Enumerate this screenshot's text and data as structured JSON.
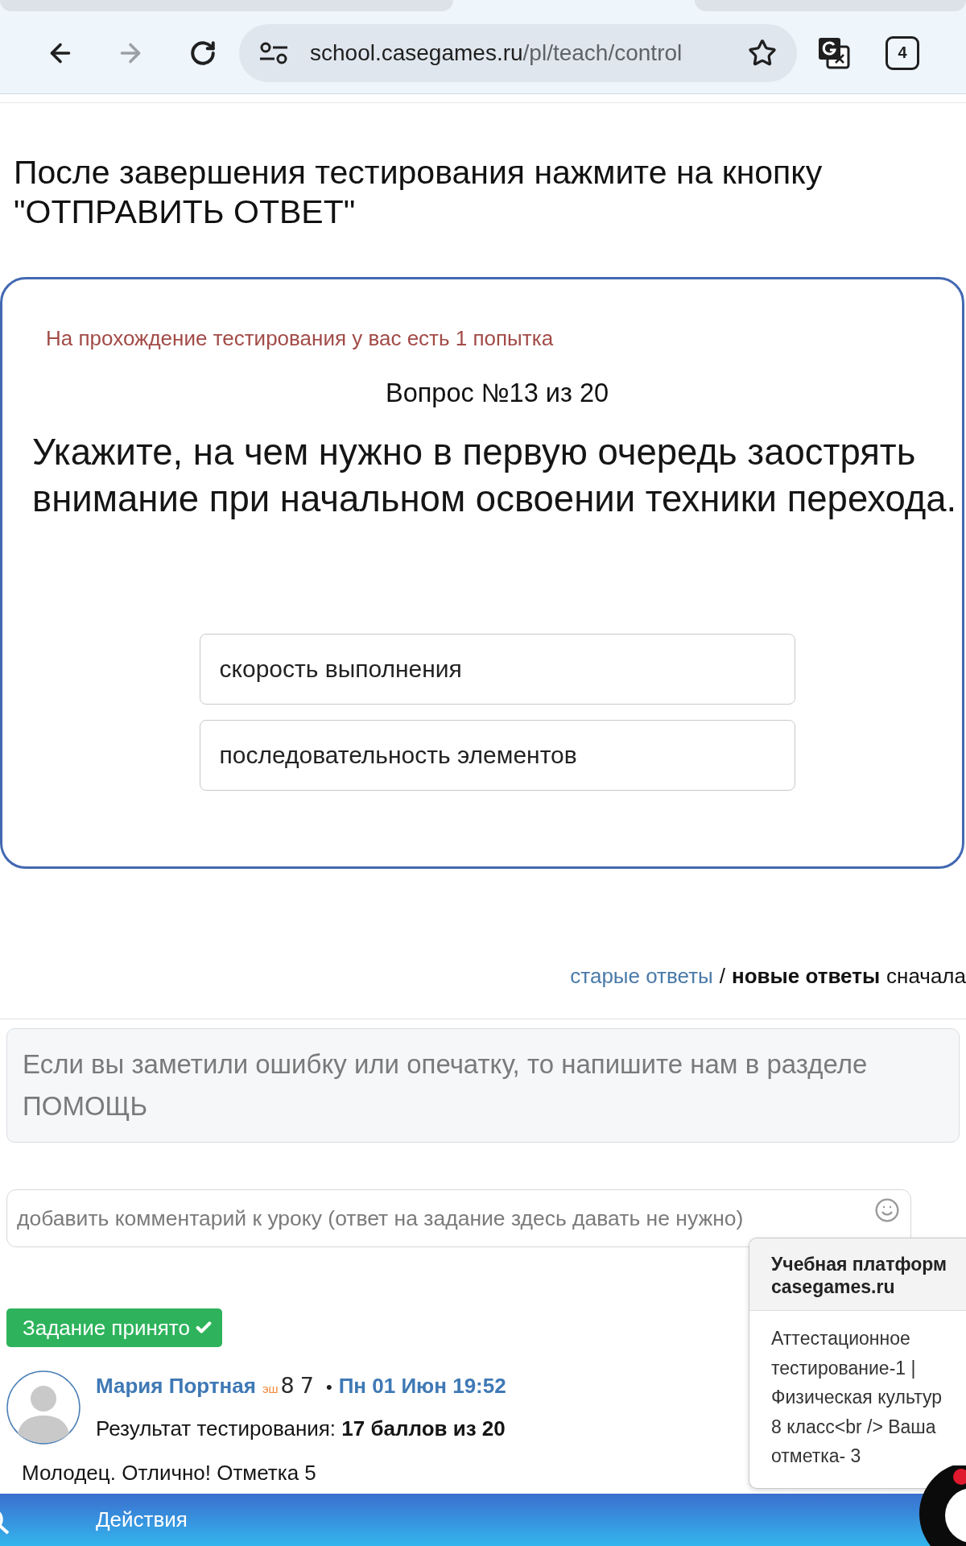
{
  "browser": {
    "tabs": [
      {
        "selected": false
      },
      {
        "selected": false
      }
    ],
    "nav": {
      "back_disabled": false,
      "forward_disabled": true
    },
    "address": {
      "host": "school.casegames.ru",
      "path": "/pl/teach/control"
    },
    "bookmarked": false,
    "tab_count": "4"
  },
  "instruction": "После завершения тестирования нажмите на кнопку \"ОТПРАВИТЬ ОТВЕТ\"",
  "quiz": {
    "attempts_note": "На прохождение тестирования у вас есть 1 попытка",
    "counter": "Вопрос №13 из 20",
    "question": "Укажите, на чем нужно в первую очередь заострять внимание при начальном освоении техники перехода.",
    "options": [
      {
        "label": "скорость выполнения",
        "selected": false
      },
      {
        "label": "последовательность элементов",
        "selected": false
      }
    ]
  },
  "answer_order": {
    "options": [
      {
        "label": "старые ответы",
        "selected": false
      },
      {
        "label": "новые ответы",
        "selected": true
      }
    ],
    "separator": "/",
    "suffix": "сначала"
  },
  "help_notice": "Если вы заметили ошибку или опечатку, то напишите нам в разделе ПОМОЩЬ",
  "comment_field": {
    "placeholder": "добавить комментарий к уроку (ответ на задание здесь давать не нужно)"
  },
  "task_status": {
    "label": "Задание принято",
    "accepted": true
  },
  "comment": {
    "author": "Мария Портная",
    "level_badge": {
      "prefix": "эш",
      "number": "87"
    },
    "separator": "•",
    "date": "Пн 01 Июн 19:52",
    "result": "Результат тестирования: **17 баллов из 20**",
    "text": "Молодец. Отлично! Отметка 5"
  },
  "notification": {
    "title": "Учебная платформ casegames.ru",
    "message": "Аттестационное тестирование-1 | Физическая культур 8 класс<br /> Ваша отметка- 3"
  },
  "bottom_bar": {
    "label": "Действия"
  },
  "chat_widget": {
    "unread": true
  }
}
